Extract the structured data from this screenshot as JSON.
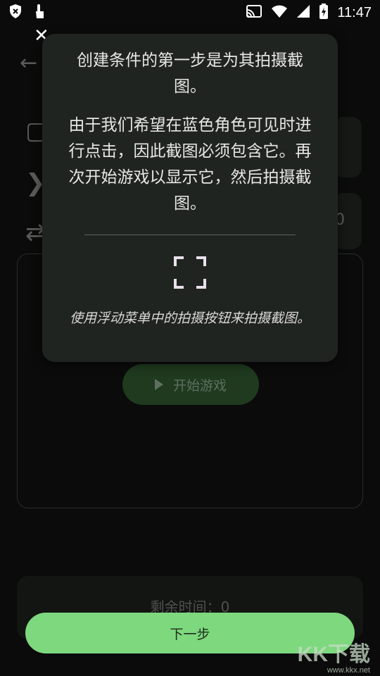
{
  "status_bar": {
    "time": "11:47",
    "icons": [
      "shield-icon",
      "touch-icon",
      "cast-icon",
      "wifi-icon",
      "signal-icon",
      "battery-charging-icon"
    ]
  },
  "background": {
    "remaining_time": "剩余时间：0",
    "zero_value": "0",
    "play_button_label": "开始游戏"
  },
  "tooltip": {
    "paragraph1": "创建条件的第一步是为其拍摄截图。",
    "paragraph2": "由于我们希望在蓝色角色可见时进行点击，因此截图必须包含它。再次开始游戏以显示它，然后拍摄截图。",
    "hint": "使用浮动菜单中的拍摄按钮来拍摄截图。",
    "frame_icon": "screenshot-frame-icon"
  },
  "next_button_label": "下一步",
  "watermark": {
    "logo": "KK下载",
    "url": "www.kkx.net"
  },
  "colors": {
    "accent_green": "#7ed87e",
    "tooltip_bg": "#202420"
  }
}
